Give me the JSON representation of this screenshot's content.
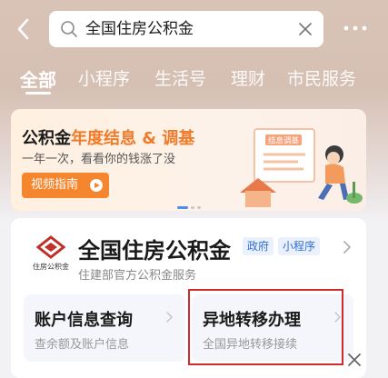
{
  "search": {
    "query": "全国住房公积金"
  },
  "tabs": [
    {
      "label": "全部"
    },
    {
      "label": "小程序"
    },
    {
      "label": "生活号"
    },
    {
      "label": "理财"
    },
    {
      "label": "市民服务"
    }
  ],
  "banner": {
    "title_part1": "公积金",
    "title_part2": "年度结息 & 调基",
    "subtitle": "一年一次，看看你的钱涨了没",
    "button_label": "视频指南",
    "illustration_board_text": "结息调基"
  },
  "result": {
    "logo_caption": "住房公积金",
    "name": "全国住房公积金",
    "tags": [
      "政府",
      "小程序"
    ],
    "description": "住建部官方公积金服务",
    "services": [
      {
        "title": "账户信息查询",
        "subtitle": "查余额及账户信息"
      },
      {
        "title": "异地转移办理",
        "subtitle": "全国异地转移接续"
      }
    ]
  },
  "colors": {
    "accent_orange": "#f5862e",
    "tag_blue": "#2f6fd6",
    "highlight_red": "#cf2b2b"
  }
}
